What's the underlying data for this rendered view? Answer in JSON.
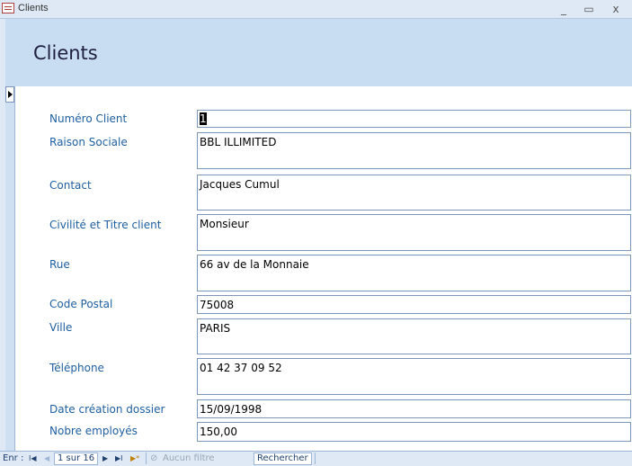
{
  "window": {
    "title": "Clients",
    "minimize_glyph": "_",
    "maximize_glyph": "▭",
    "close_glyph": "x"
  },
  "form": {
    "title": "Clients",
    "fields": [
      {
        "label": "Numéro Client",
        "value": "1"
      },
      {
        "label": "Raison Sociale",
        "value": "BBL ILLIMITED"
      },
      {
        "label": "Contact",
        "value": "Jacques Cumul"
      },
      {
        "label": "Civilité et Titre client",
        "value": "Monsieur"
      },
      {
        "label": "Rue",
        "value": "66 av de la Monnaie"
      },
      {
        "label": "Code Postal",
        "value": "75008"
      },
      {
        "label": "Ville",
        "value": "PARIS"
      },
      {
        "label": "Téléphone",
        "value": "01 42 37 09 52"
      },
      {
        "label": "Date création dossier",
        "value": "15/09/1998"
      },
      {
        "label": "Nobre employés",
        "value": "150,00"
      }
    ]
  },
  "navigation": {
    "record_label": "Enr :",
    "first_glyph": "I◀",
    "prev_glyph": "◀",
    "current": "1 sur 16",
    "next_glyph": "▶",
    "last_glyph": "▶I",
    "new_glyph": "▶*",
    "filter_icon": "filter-icon",
    "filter_label": "Aucun filtre",
    "search_label": "Rechercher"
  }
}
